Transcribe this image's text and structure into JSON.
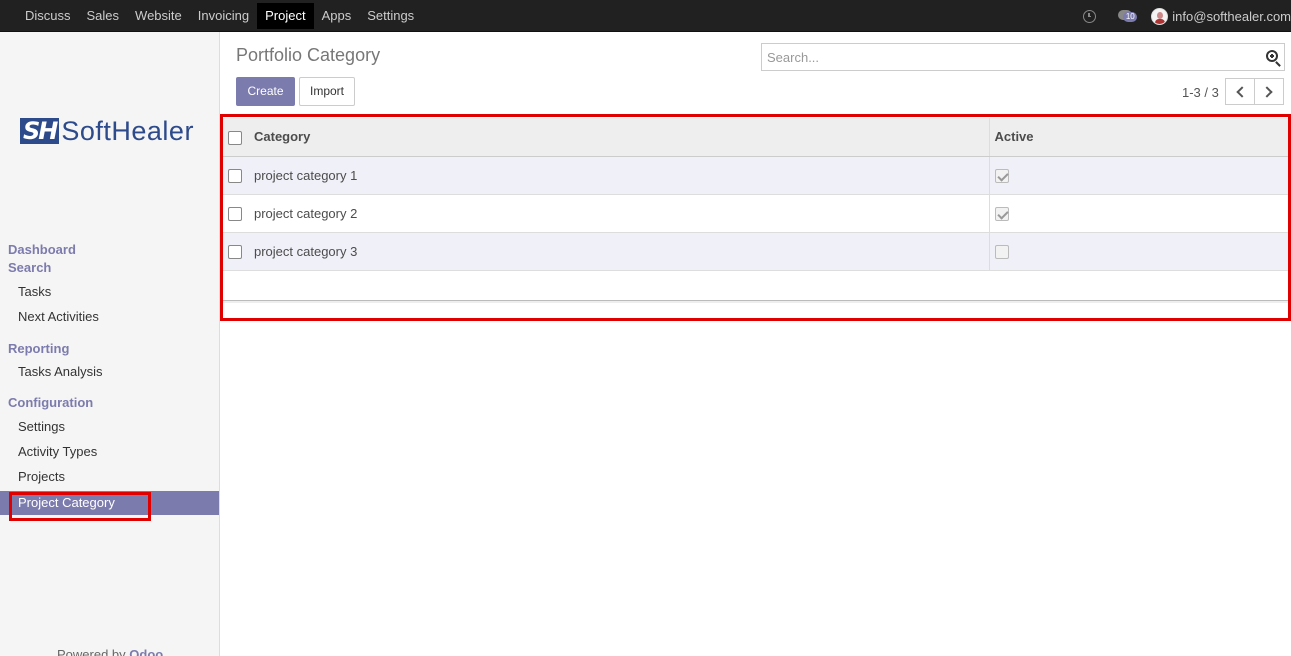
{
  "topbar": {
    "nav": [
      "Discuss",
      "Sales",
      "Website",
      "Invoicing",
      "Project",
      "Apps",
      "Settings"
    ],
    "active_nav": "Project",
    "message_count": "10",
    "user_email": "info@softhealer.com"
  },
  "sidebar": {
    "logo": {
      "mark": "SH",
      "text": "SoftHealer"
    },
    "sections": {
      "dashboard": "Dashboard",
      "search": "Search",
      "reporting": "Reporting",
      "configuration": "Configuration"
    },
    "items": {
      "tasks": "Tasks",
      "next_activities": "Next Activities",
      "tasks_analysis": "Tasks Analysis",
      "settings": "Settings",
      "activity_types": "Activity Types",
      "projects": "Projects",
      "project_category": "Project Category"
    },
    "powered_by": {
      "prefix": "Powered by ",
      "brand": "Odoo"
    }
  },
  "control_panel": {
    "title": "Portfolio Category",
    "search_placeholder": "Search...",
    "create_label": "Create",
    "import_label": "Import",
    "pager": "1-3 / 3"
  },
  "table": {
    "columns": {
      "category": "Category",
      "active": "Active"
    },
    "rows": [
      {
        "category": "project category 1",
        "active": true
      },
      {
        "category": "project category 2",
        "active": true
      },
      {
        "category": "project category 3",
        "active": false
      }
    ]
  },
  "colors": {
    "brand": "#7c7bad",
    "highlight": "#e00000",
    "topbar": "#212121"
  }
}
